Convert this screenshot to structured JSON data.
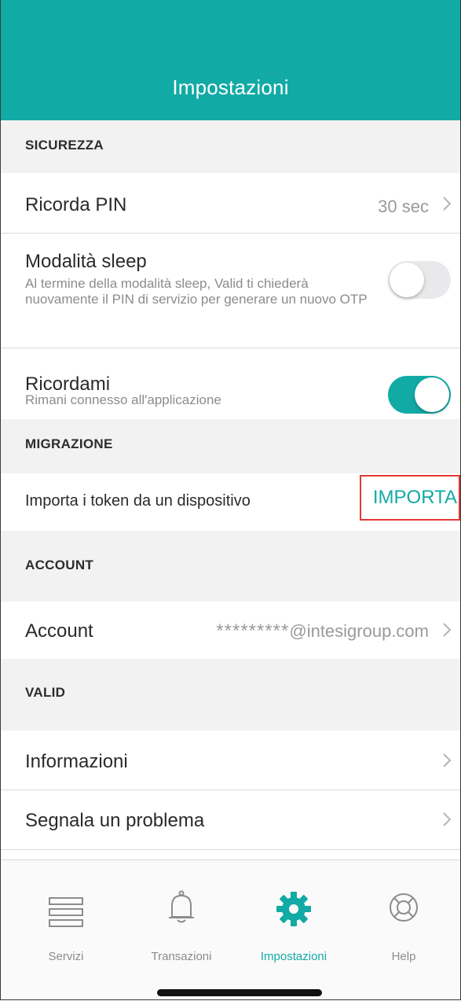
{
  "header": {
    "title": "Impostazioni"
  },
  "sections": {
    "security": "SICUREZZA",
    "migration": "MIGRAZIONE",
    "account": "ACCOUNT",
    "valid": "VALID"
  },
  "security": {
    "remember_pin": {
      "label": "Ricorda PIN",
      "value": "30 sec"
    },
    "sleep_mode": {
      "label": "Modalità sleep",
      "description": "Al termine della modalità sleep, Valid ti chiederà nuovamente il PIN di servizio per generare un nuovo OTP",
      "enabled": false
    },
    "remember_me": {
      "label": "Ricordami",
      "description": "Rimani connesso all'applicazione",
      "enabled": true
    }
  },
  "migration": {
    "import_label": "Importa i token da un dispositivo",
    "import_button": "IMPORTA"
  },
  "account": {
    "label": "Account",
    "masked": "*********",
    "domain": "@intesigroup.com"
  },
  "valid": {
    "info": "Informazioni",
    "report": "Segnala un problema"
  },
  "tabbar": {
    "items": [
      {
        "label": "Servizi",
        "icon": "list-icon"
      },
      {
        "label": "Transazioni",
        "icon": "bell-icon"
      },
      {
        "label": "Impostazioni",
        "icon": "gear-icon",
        "active": true
      },
      {
        "label": "Help",
        "icon": "lifebuoy-icon"
      }
    ]
  },
  "colors": {
    "accent": "#12aaa5",
    "highlight": "#e53935"
  }
}
